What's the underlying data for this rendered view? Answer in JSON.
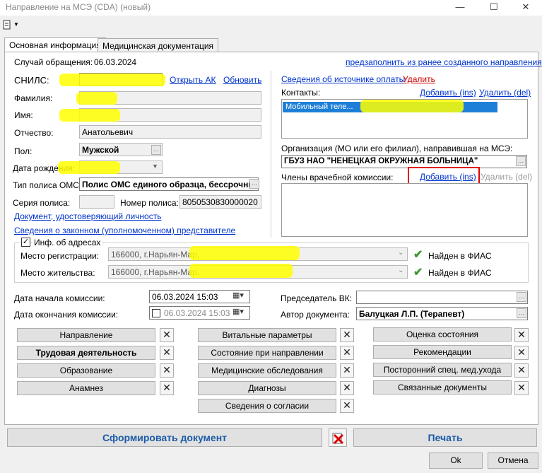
{
  "window": {
    "title": "Направление на МСЭ (CDA) (новый)",
    "minimize": "—",
    "maximize": "☐",
    "close": "✕"
  },
  "tabs": [
    "Основная информация",
    "Медицинская документация"
  ],
  "left": {
    "case_label": "Случай обращения:",
    "case_value": "06.03.2024",
    "snils_label": "СНИЛС:",
    "open_ak": "Открыть АК",
    "refresh": "Обновить",
    "surname_label": "Фамилия:",
    "name_label": "Имя:",
    "patronymic_label": "Отчество:",
    "patronymic_value": "Анатольевич",
    "sex_label": "Пол:",
    "sex_value": "Мужской",
    "birth_label": "Дата рождения:",
    "policy_type_label": "Тип полиса ОМС:",
    "policy_type_value": "Полис ОМС единого образца, бессрочны",
    "policy_series_label": "Серия полиса:",
    "policy_number_label": "Номер полиса:",
    "policy_number_value": "8050530830000020",
    "identity_doc_link": "Документ, удостоверяющий личность",
    "representative_link": "Сведения о законном (уполномоченном) представителе"
  },
  "right": {
    "payment_link": "Сведения об источнике оплаты",
    "delete_link": "Удалить",
    "contacts_label": "Контакты:",
    "add_ins": "Добавить (ins)",
    "del_del": "Удалить (del)",
    "contact_row": "Мобильный теле...",
    "org_label": "Организация (МО или его филиал), направившая на МСЭ:",
    "org_value": "ГБУЗ НАО \"НЕНЕЦКАЯ ОКРУЖНАЯ БОЛЬНИЦА\"",
    "commission_label": "Члены врачебной комиссии:",
    "commission_add": "Добавить (ins)",
    "commission_del": "Удалить (del)",
    "prefill_link": "предзаполнить из ранее созданного направления"
  },
  "address": {
    "group_label": "Инф. об адресах",
    "reg_label": "Место регистрации:",
    "reg_value": "166000, г.Нарьян-Мар,",
    "live_label": "Место жительства:",
    "live_value": "166000, г.Нарьян-Мар,",
    "fias": "Найден в ФИАС"
  },
  "dates": {
    "start_label": "Дата начала комиссии:",
    "start_value": "06.03.2024 15:03",
    "end_label": "Дата окончания комиссии:",
    "end_value": "06.03.2024 15:03",
    "chair_label": "Председатель ВК:",
    "author_label": "Автор документа:",
    "author_value": "Балуцкая Л.П. (Терапевт)"
  },
  "sections": {
    "col1": [
      "Направление",
      "Трудовая деятельность",
      "Образование",
      "Анамнез"
    ],
    "col2": [
      "Витальные параметры",
      "Состояние при направлении",
      "Медицинские обследования",
      "Диагнозы",
      "Сведения о согласии"
    ],
    "col3": [
      "Оценка состояния",
      "Рекомендации",
      "Посторонний спец. мед.ухода",
      "Связанные документы"
    ]
  },
  "footer": {
    "generate": "Сформировать документ",
    "print": "Печать",
    "ok": "Ok",
    "cancel": "Отмена"
  },
  "colors": {
    "highlight": "#ffff00",
    "link": "#0033cc",
    "red_box": "#e00000",
    "selected_row": "#1e7fd8"
  }
}
